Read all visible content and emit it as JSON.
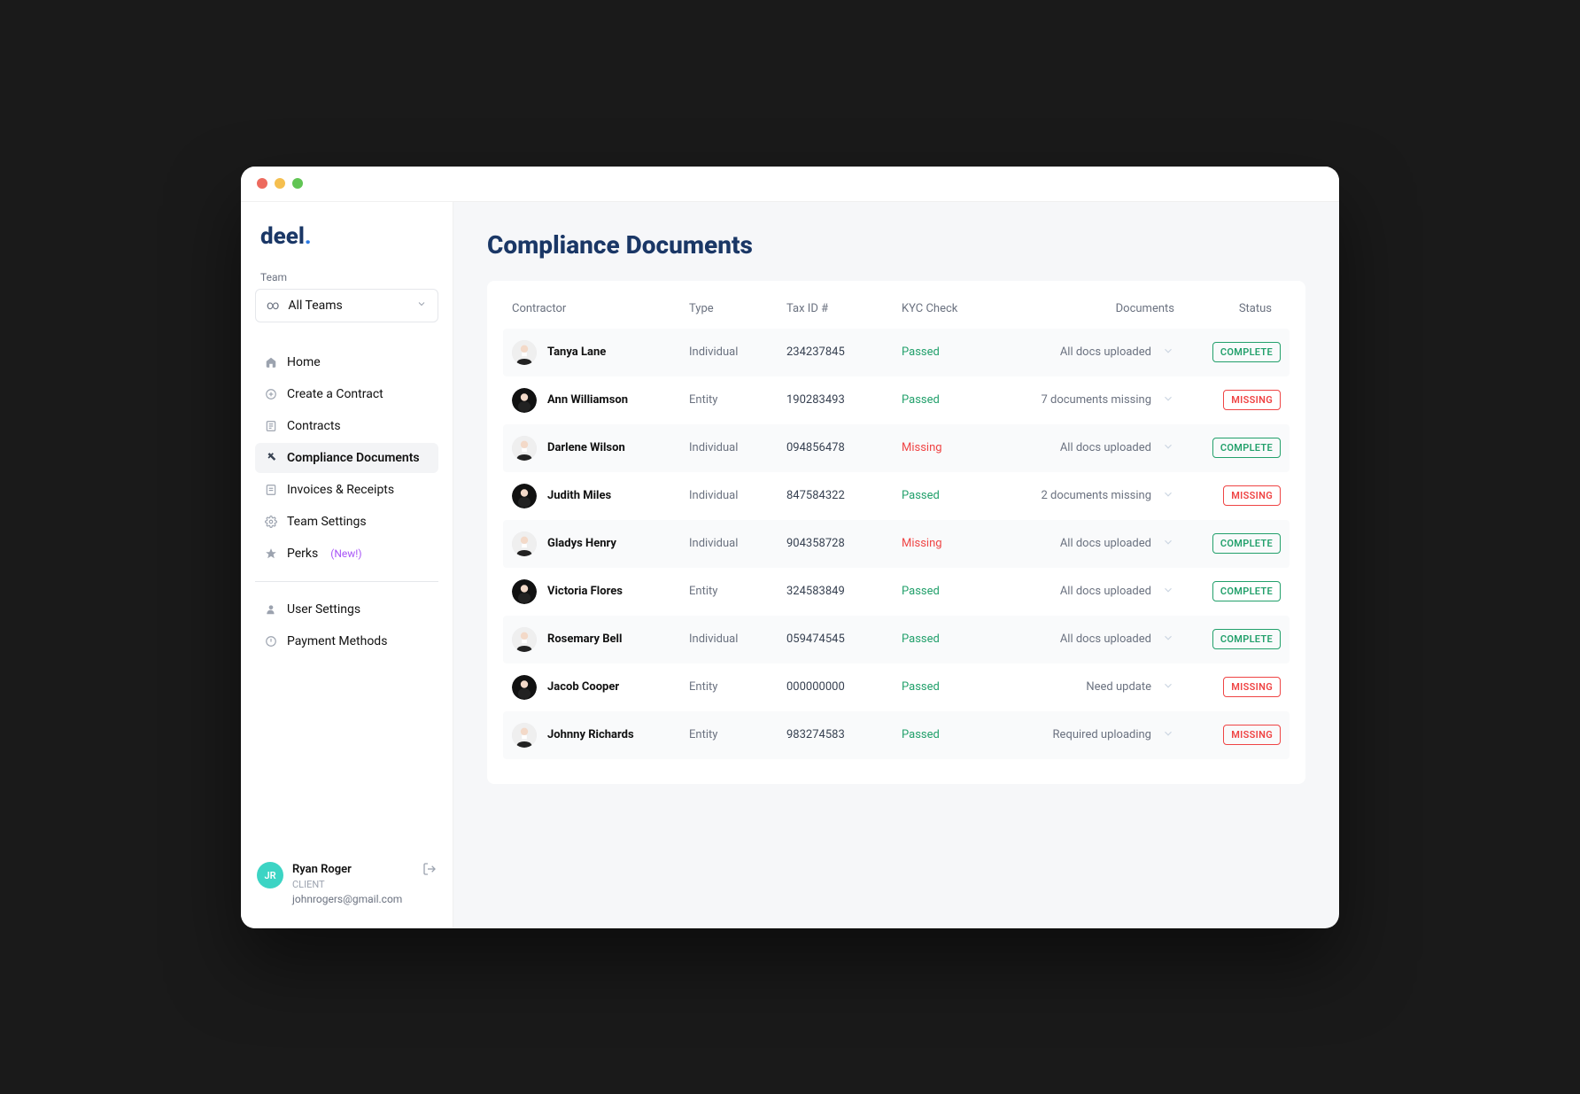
{
  "logo": {
    "text": "deel",
    "accent": "."
  },
  "sidebar": {
    "team_label": "Team",
    "team_selected": "All Teams",
    "nav": [
      {
        "label": "Home"
      },
      {
        "label": "Create a Contract"
      },
      {
        "label": "Contracts"
      },
      {
        "label": "Compliance Documents",
        "active": true
      },
      {
        "label": "Invoices & Receipts"
      },
      {
        "label": "Team Settings"
      },
      {
        "label": "Perks",
        "badge": "(New!)"
      }
    ],
    "secondary_nav": [
      {
        "label": "User Settings"
      },
      {
        "label": "Payment Methods"
      }
    ],
    "user": {
      "initials": "JR",
      "name": "Ryan Roger",
      "role": "CLIENT",
      "email": "johnrogers@gmail.com"
    }
  },
  "page": {
    "title": "Compliance Documents",
    "columns": {
      "contractor": "Contractor",
      "type": "Type",
      "taxid": "Tax ID #",
      "kyc": "KYC Check",
      "documents": "Documents",
      "status": "Status"
    },
    "rows": [
      {
        "name": "Tanya Lane",
        "type": "Individual",
        "taxid": "234237845",
        "kyc": "Passed",
        "kyc_state": "passed",
        "documents": "All docs uploaded",
        "status": "COMPLETE",
        "status_state": "complete",
        "avatar": "light"
      },
      {
        "name": "Ann Williamson",
        "type": "Entity",
        "taxid": "190283493",
        "kyc": "Passed",
        "kyc_state": "passed",
        "documents": "7 documents missing",
        "status": "MISSING",
        "status_state": "missing",
        "avatar": "dark"
      },
      {
        "name": "Darlene Wilson",
        "type": "Individual",
        "taxid": "094856478",
        "kyc": "Missing",
        "kyc_state": "missing",
        "documents": "All docs uploaded",
        "status": "COMPLETE",
        "status_state": "complete",
        "avatar": "light"
      },
      {
        "name": "Judith Miles",
        "type": "Individual",
        "taxid": "847584322",
        "kyc": "Passed",
        "kyc_state": "passed",
        "documents": "2 documents missing",
        "status": "MISSING",
        "status_state": "missing",
        "avatar": "dark"
      },
      {
        "name": "Gladys Henry",
        "type": "Individual",
        "taxid": "904358728",
        "kyc": "Missing",
        "kyc_state": "missing",
        "documents": "All docs uploaded",
        "status": "COMPLETE",
        "status_state": "complete",
        "avatar": "light"
      },
      {
        "name": "Victoria Flores",
        "type": "Entity",
        "taxid": "324583849",
        "kyc": "Passed",
        "kyc_state": "passed",
        "documents": "All docs uploaded",
        "status": "COMPLETE",
        "status_state": "complete",
        "avatar": "dark"
      },
      {
        "name": "Rosemary Bell",
        "type": "Individual",
        "taxid": "059474545",
        "kyc": "Passed",
        "kyc_state": "passed",
        "documents": "All docs uploaded",
        "status": "COMPLETE",
        "status_state": "complete",
        "avatar": "light"
      },
      {
        "name": "Jacob Cooper",
        "type": "Entity",
        "taxid": "000000000",
        "kyc": "Passed",
        "kyc_state": "passed",
        "documents": "Need update",
        "status": "MISSING",
        "status_state": "missing",
        "avatar": "dark"
      },
      {
        "name": "Johnny Richards",
        "type": "Entity",
        "taxid": "983274583",
        "kyc": "Passed",
        "kyc_state": "passed",
        "documents": "Required uploading",
        "status": "MISSING",
        "status_state": "missing",
        "avatar": "light"
      }
    ]
  }
}
